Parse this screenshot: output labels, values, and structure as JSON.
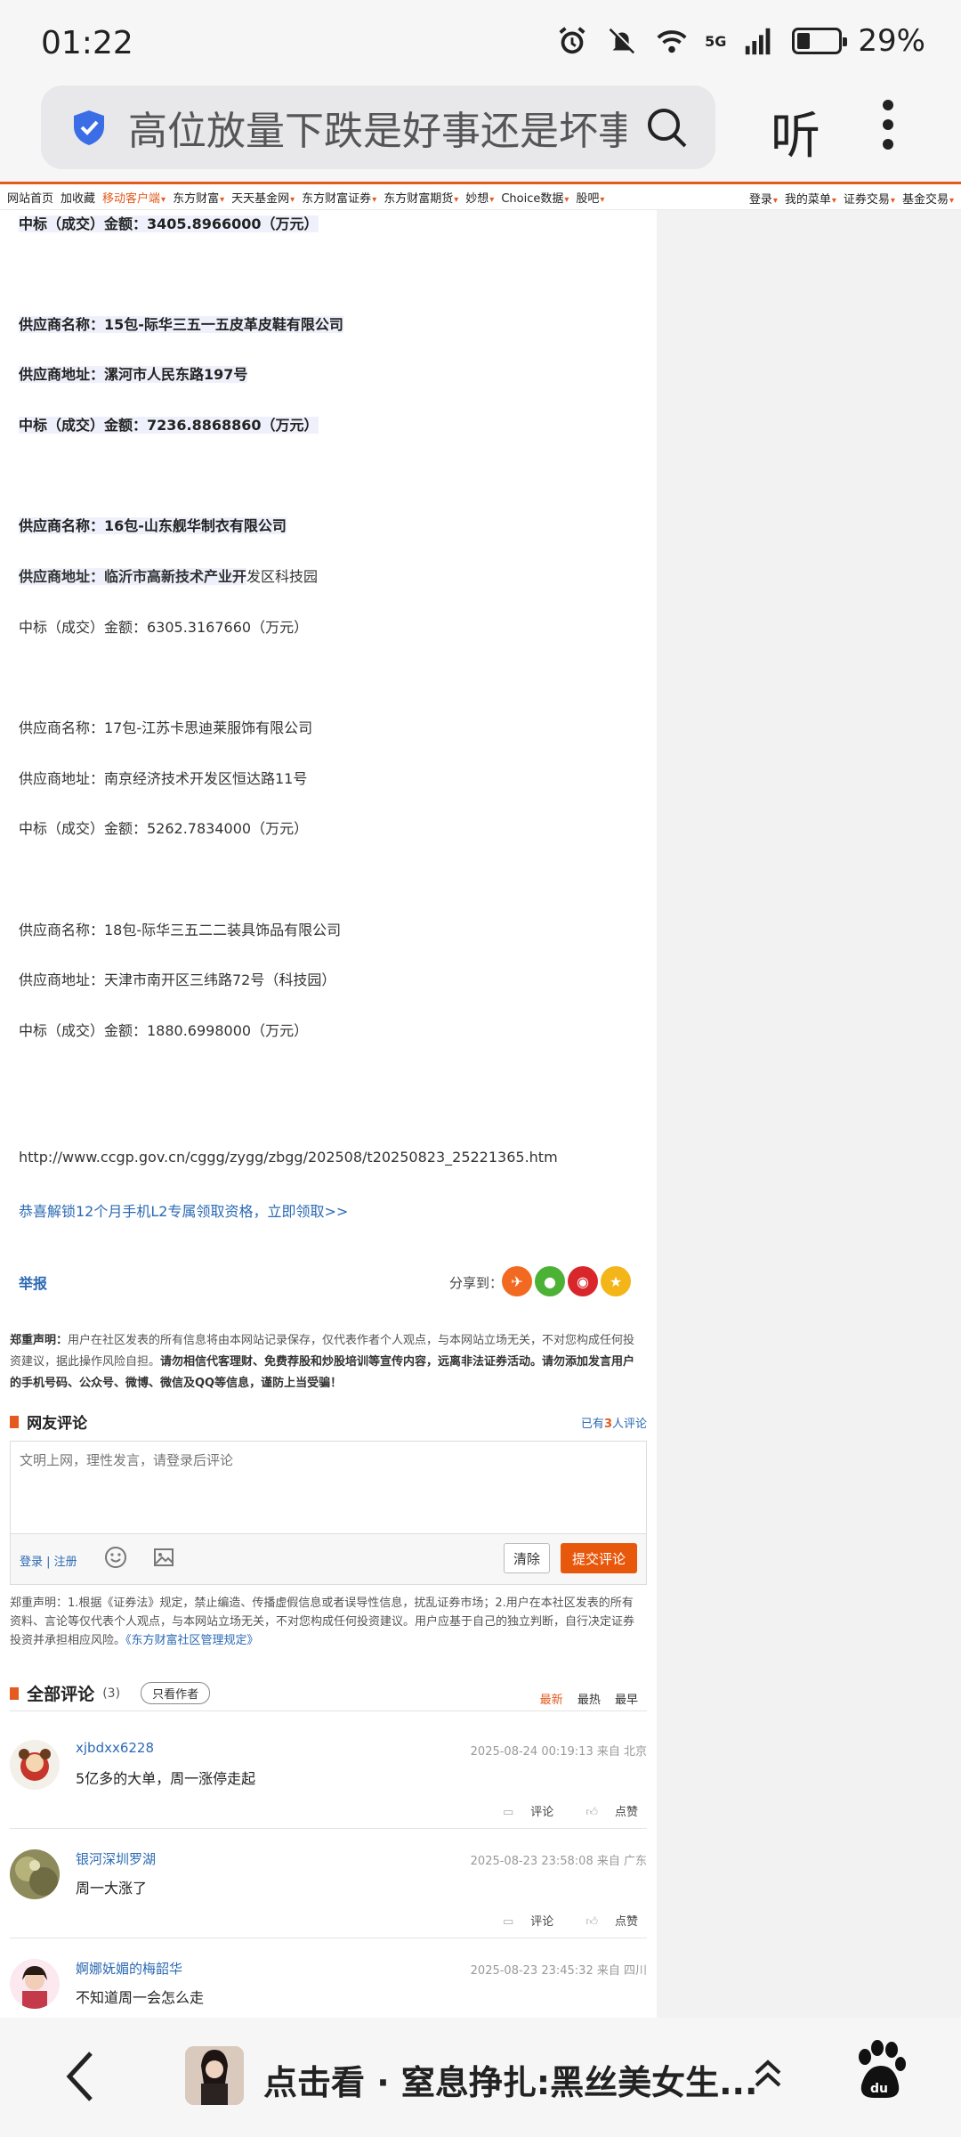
{
  "status_bar": {
    "time": "01:22",
    "network": "5G",
    "battery": "29%"
  },
  "search": {
    "query": "高位放量下跌是好事还是坏事",
    "listen_label": "听"
  },
  "site_nav": {
    "left_items": [
      "网站首页",
      "加收藏",
      "移动客户端",
      "东方财富",
      "天天基金网",
      "东方财富证券",
      "东方财富期货",
      "妙想",
      "Choice数据",
      "股吧"
    ],
    "right_items": [
      "登录",
      "我的菜单",
      "证券交易",
      "基金交易"
    ]
  },
  "article": {
    "lines": [
      "中标（成交）金额：3405.8966000（万元）",
      "供应商名称：15包-际华三五一五皮革皮鞋有限公司",
      "供应商地址：漯河市人民东路197号",
      "中标（成交）金额：7236.8868860（万元）",
      "供应商名称：16包-山东舰华制衣有限公司",
      "供应商地址：临沂市高新技术产业开",
      "发区科技园",
      "中标（成交）金额：6305.3167660（万元）",
      "供应商名称：17包-江苏卡思迪莱服饰有限公司",
      "供应商地址：南京经济技术开发区恒达路11号",
      "中标（成交）金额：5262.7834000（万元）",
      "供应商名称：18包-际华三五二二装具饰品有限公司",
      "供应商地址：天津市南开区三纬路72号（科技园）",
      "中标（成交）金额：1880.6998000（万元）"
    ],
    "source_url": "http://www.ccgp.gov.cn/cggg/zygg/zbgg/202508/t20250823_25221365.htm",
    "promo_link": "恭喜解锁12个月手机L2专属领取资格，立即领取>>",
    "report_label": "举报",
    "share_label": "分享到："
  },
  "disclaimer_top": {
    "label": "郑重声明：",
    "text": "用户在社区发表的所有信息将由本网站记录保存，仅代表作者个人观点，与本网站立场无关，不对您构成任何投资建议，据此操作风险自担。",
    "bold_text": "请勿相信代客理财、免费荐股和炒股培训等宣传内容，远离非法证券活动。请勿添加发言用户的手机号码、公众号、微博、微信及QQ等信息，谨防上当受骗！"
  },
  "comments_section": {
    "title": "网友评论",
    "count_prefix": "已有",
    "count": "3",
    "count_suffix": "人评论",
    "placeholder": "文明上网，理性发言，请登录后评论",
    "login_label": "登录 | 注册",
    "clear_label": "清除",
    "submit_label": "提交评论",
    "rules_text": "郑重声明：1.根据《证券法》规定，禁止编造、传播虚假信息或者误导性信息，扰乱证券市场；2.用户在本社区发表的所有资料、言论等仅代表个人观点，与本网站立场无关，不对您构成任何投资建议。用户应基于自己的独立判断，自行决定证券投资并承担相应风险。",
    "rules_link": "《东方财富社区管理规定》"
  },
  "all_comments": {
    "title": "全部评论",
    "count": "(3)",
    "author_only": "只看作者",
    "sort": [
      "最新",
      "最热",
      "最早"
    ],
    "reply_label": "评论",
    "like_label": "点赞",
    "items": [
      {
        "user": "xjbdxx6228",
        "time": "2025-08-24 00:19:13 来自 北京",
        "text": "5亿多的大单，周一涨停走起"
      },
      {
        "user": "银河深圳罗湖",
        "time": "2025-08-23 23:58:08 来自 广东",
        "text": "周一大涨了"
      },
      {
        "user": "婀娜妩媚的梅韶华",
        "time": "2025-08-23 23:45:32 来自 四川",
        "text": "不知道周一会怎么走"
      }
    ]
  },
  "bottom_bar": {
    "title": "点击看 · 窒息挣扎:黑丝美女生..."
  },
  "colors": {
    "accent": "#e45a1f",
    "link": "#2c6ab3",
    "submit": "#e8580c"
  }
}
